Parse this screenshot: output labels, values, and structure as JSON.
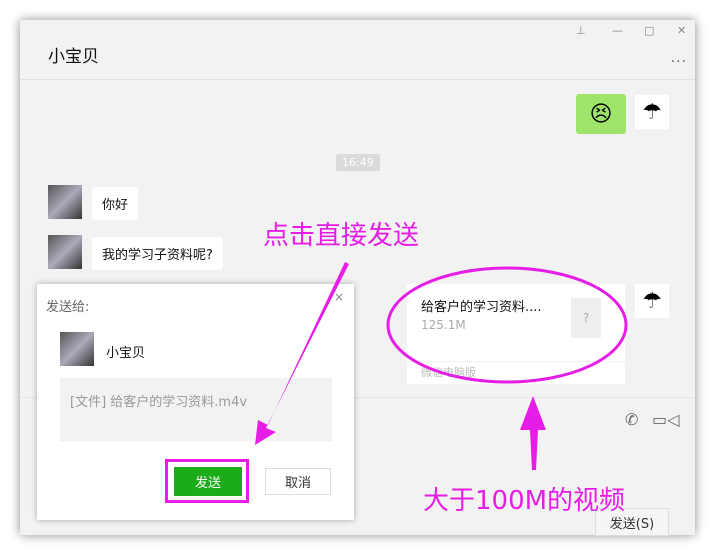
{
  "window": {
    "title": "小宝贝",
    "controls": [
      "pin",
      "minimize",
      "maximize",
      "close"
    ],
    "more": "..."
  },
  "messages": {
    "time": "16:49",
    "hello": "你好",
    "question": "我的学习子资料呢?",
    "emoji": "😣"
  },
  "file_card": {
    "name": "给客户的学习资料....",
    "size": "125.1M",
    "icon": "?",
    "footer": "微信电脑版"
  },
  "input": {
    "send_label": "发送(S)"
  },
  "dialog": {
    "header": "发送给:",
    "recipient": "小宝贝",
    "content": "[文件] 给客户的学习资料.m4v",
    "send": "发送",
    "cancel": "取消",
    "close": "×"
  },
  "annotations": {
    "click_send": "点击直接发送",
    "large_video": "大于100M的视频"
  },
  "colors": {
    "accent": "#1aad19",
    "annotation": "#e61de6"
  }
}
